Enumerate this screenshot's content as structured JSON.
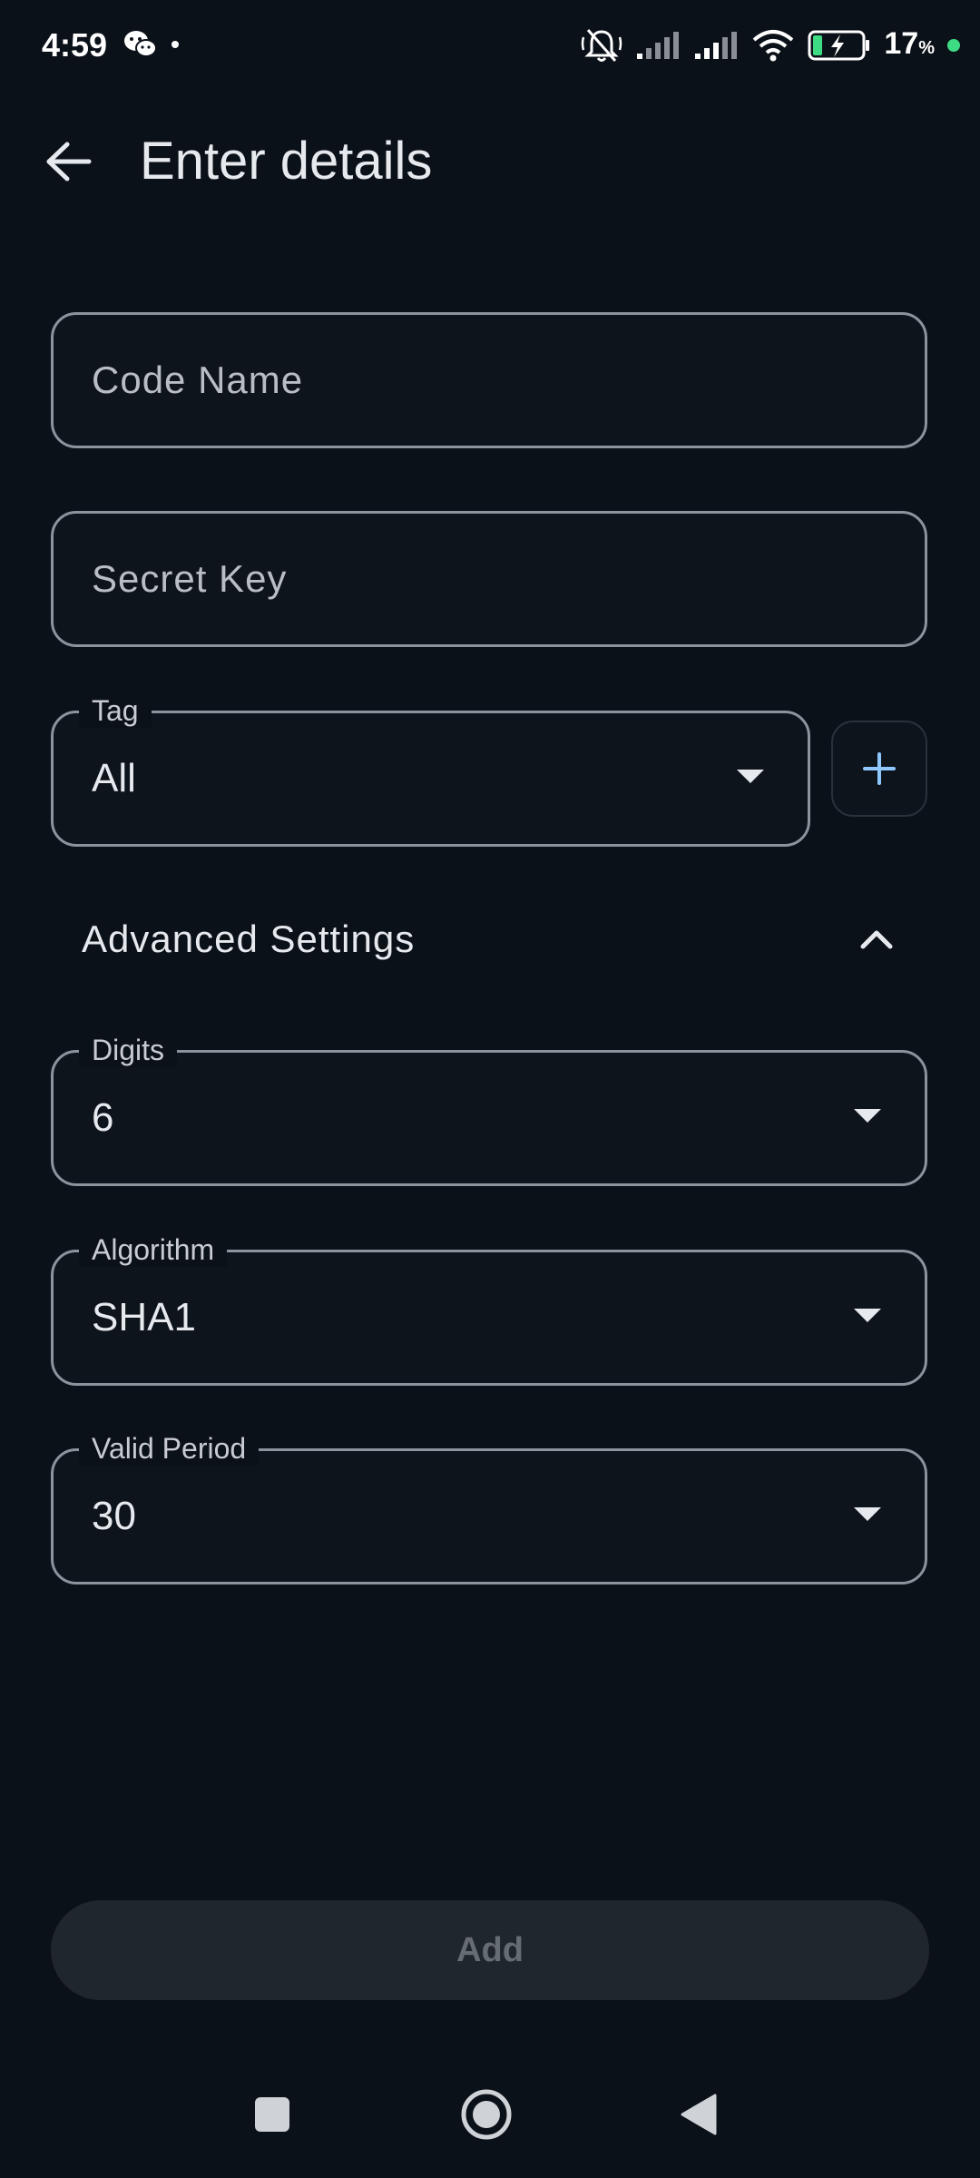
{
  "status_bar": {
    "time": "4:59",
    "battery_percent": "17",
    "battery_unit": "%"
  },
  "app_bar": {
    "title": "Enter details"
  },
  "form": {
    "code_name_placeholder": "Code Name",
    "secret_key_placeholder": "Secret Key",
    "tag_label": "Tag",
    "tag_value": "All"
  },
  "advanced": {
    "title": "Advanced Settings",
    "digits_label": "Digits",
    "digits_value": "6",
    "algorithm_label": "Algorithm",
    "algorithm_value": "SHA1",
    "period_label": "Valid Period",
    "period_value": "30"
  },
  "actions": {
    "add_label": "Add"
  },
  "colors": {
    "background": "#0b1118",
    "accent": "#8fc8ff",
    "outline": "#8c939c",
    "disabled_button": "#20272c"
  }
}
